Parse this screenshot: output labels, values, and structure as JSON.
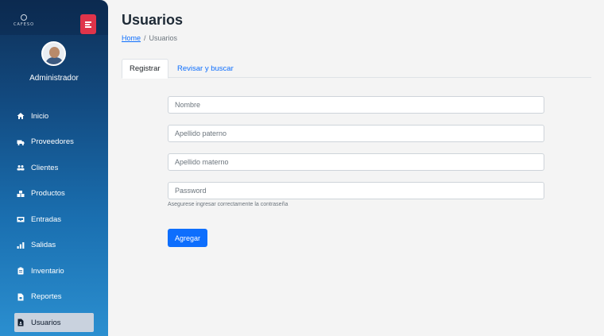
{
  "sidebar": {
    "logo_text": "CAFESO",
    "user_role": "Administrador",
    "items": [
      {
        "label": "Inicio",
        "icon": "home-icon"
      },
      {
        "label": "Proveedores",
        "icon": "truck-icon"
      },
      {
        "label": "Clientes",
        "icon": "users-icon"
      },
      {
        "label": "Productos",
        "icon": "boxes-icon"
      },
      {
        "label": "Entradas",
        "icon": "inbox-icon"
      },
      {
        "label": "Salidas",
        "icon": "outbox-icon"
      },
      {
        "label": "Inventario",
        "icon": "clipboard-icon"
      },
      {
        "label": "Reportes",
        "icon": "file-icon"
      },
      {
        "label": "Usuarios",
        "icon": "user-file-icon"
      }
    ],
    "active_item": "Usuarios"
  },
  "page": {
    "title": "Usuarios",
    "breadcrumb": {
      "home": "Home",
      "separator": "/",
      "current": "Usuarios"
    }
  },
  "tabs": [
    {
      "label": "Registrar",
      "active": true
    },
    {
      "label": "Revisar y buscar",
      "active": false
    }
  ],
  "form": {
    "fields": [
      {
        "placeholder": "Nombre",
        "value": ""
      },
      {
        "placeholder": "Apellido paterno",
        "value": ""
      },
      {
        "placeholder": "Apellido materno",
        "value": ""
      },
      {
        "placeholder": "Password",
        "value": ""
      }
    ],
    "password_help": "Asegurese ingresar correctamente la contraseña",
    "submit_label": "Agregar"
  },
  "colors": {
    "accent": "#0d6efd",
    "toggle": "#e0344a",
    "sidebar_top": "#0f2f56",
    "sidebar_bottom": "#2b8fd0"
  }
}
